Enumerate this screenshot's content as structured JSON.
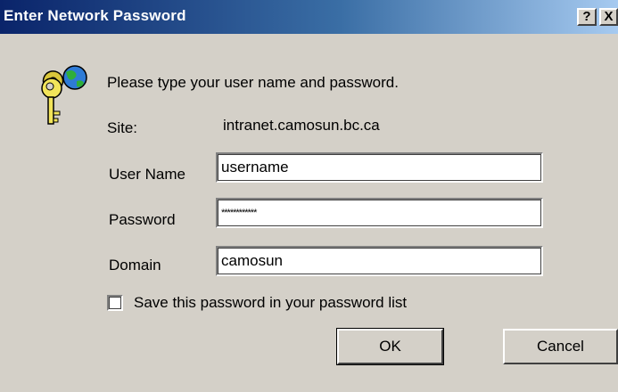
{
  "window": {
    "title": "Enter Network Password",
    "help_label": "?",
    "close_label": "X"
  },
  "dialog": {
    "instruction": "Please type your user name and password.",
    "site_label": "Site:",
    "site_value": "intranet.camosun.bc.ca",
    "username_label": "User Name",
    "username_value": "username",
    "password_label": "Password",
    "password_value": "************",
    "domain_label": "Domain",
    "domain_value": "camosun",
    "save_password_label": "Save this password in your password list",
    "save_password_checked": false,
    "ok_label": "OK",
    "cancel_label": "Cancel"
  },
  "icons": {
    "dialog_icon": "keys-with-globe-icon"
  },
  "colors": {
    "titlebar_start": "#0a246a",
    "titlebar_end": "#a6caf0",
    "face": "#d4d0c8"
  }
}
